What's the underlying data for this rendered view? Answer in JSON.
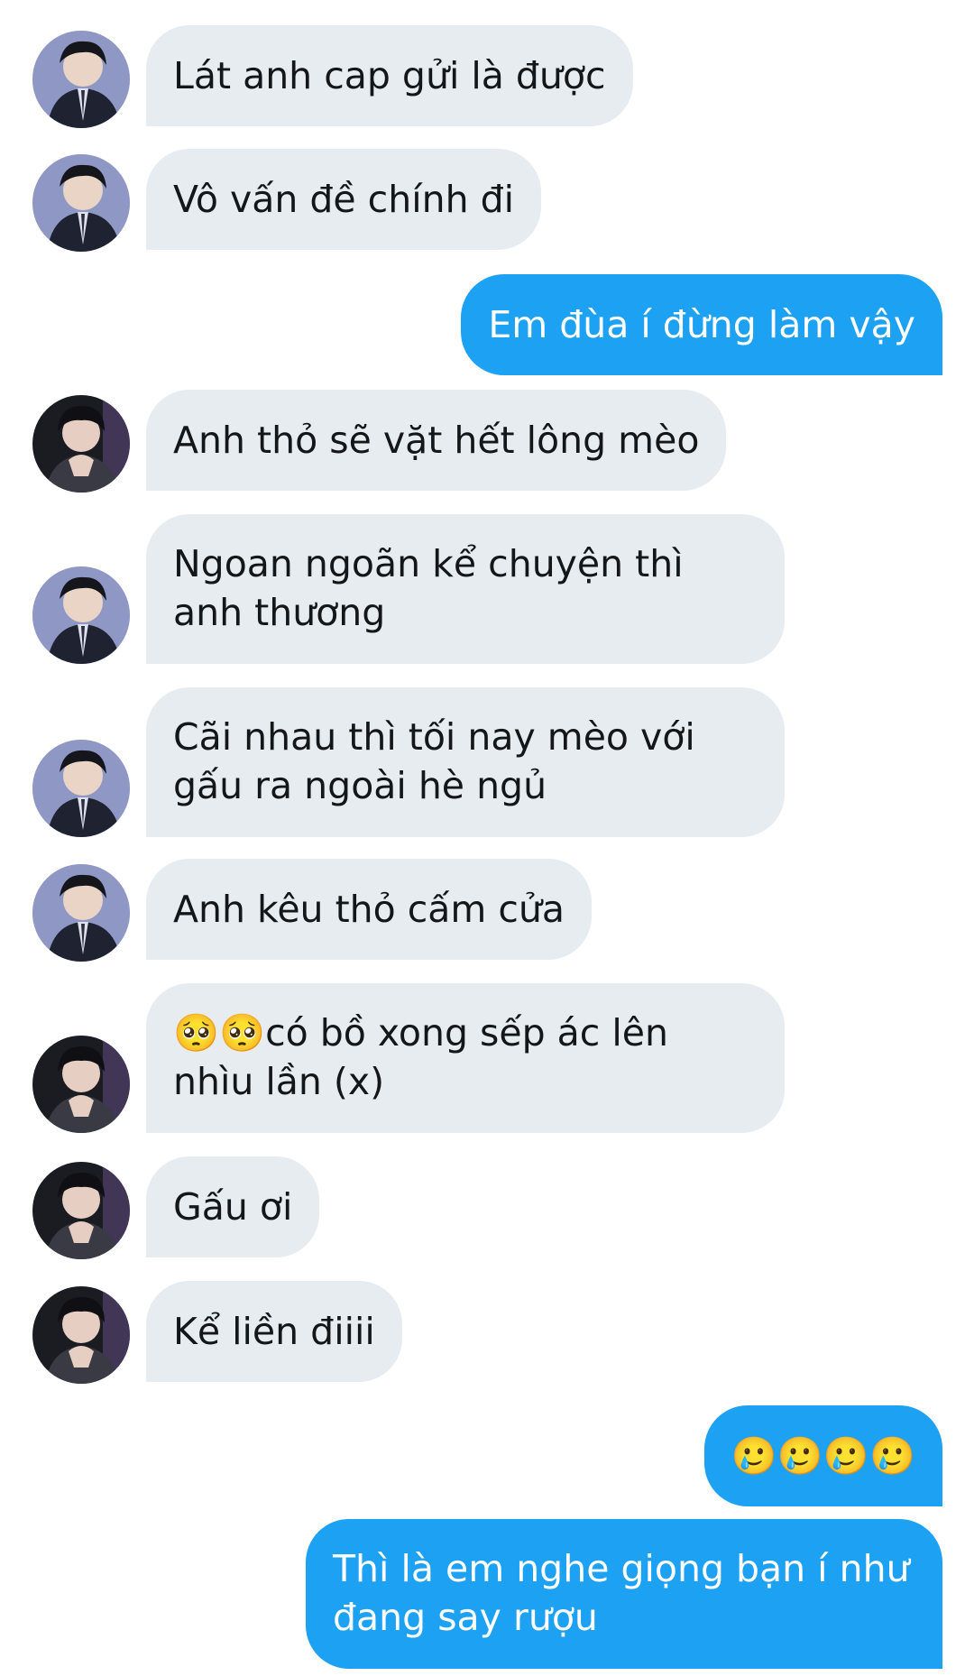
{
  "colors": {
    "incoming_bubble": "#e6ecf0",
    "outgoing_bubble": "#1da1f2",
    "incoming_text": "#14171a",
    "outgoing_text": "#ffffff"
  },
  "messages": [
    {
      "sender": "contact",
      "avatar": "avatar-suit-a",
      "text": "Lát anh cap gửi là được"
    },
    {
      "sender": "contact",
      "avatar": "avatar-suit-a",
      "text": "Vô vấn đề chính đi"
    },
    {
      "sender": "me",
      "text": "Em đùa í đừng làm vậy"
    },
    {
      "sender": "contact",
      "avatar": "avatar-dark-b",
      "text": "Anh thỏ sẽ vặt hết lông mèo"
    },
    {
      "sender": "contact",
      "avatar": "avatar-suit-a",
      "text": "Ngoan ngoãn kể chuyện thì anh thương"
    },
    {
      "sender": "contact",
      "avatar": "avatar-suit-a",
      "text": "Cãi nhau thì tối nay mèo với gấu ra ngoài hè ngủ"
    },
    {
      "sender": "contact",
      "avatar": "avatar-suit-a",
      "text": "Anh kêu thỏ cấm cửa"
    },
    {
      "sender": "contact",
      "avatar": "avatar-dark-b",
      "text": "🥺🥺có bồ xong sếp ác lên nhìu lần (x)"
    },
    {
      "sender": "contact",
      "avatar": "avatar-dark-b",
      "text": "Gấu ơi"
    },
    {
      "sender": "contact",
      "avatar": "avatar-dark-b",
      "text": "Kể liền điiii"
    },
    {
      "sender": "me",
      "text": "🥲🥲🥲🥲"
    },
    {
      "sender": "me",
      "text": "Thì là em nghe giọng bạn í như đang say rượu"
    }
  ]
}
